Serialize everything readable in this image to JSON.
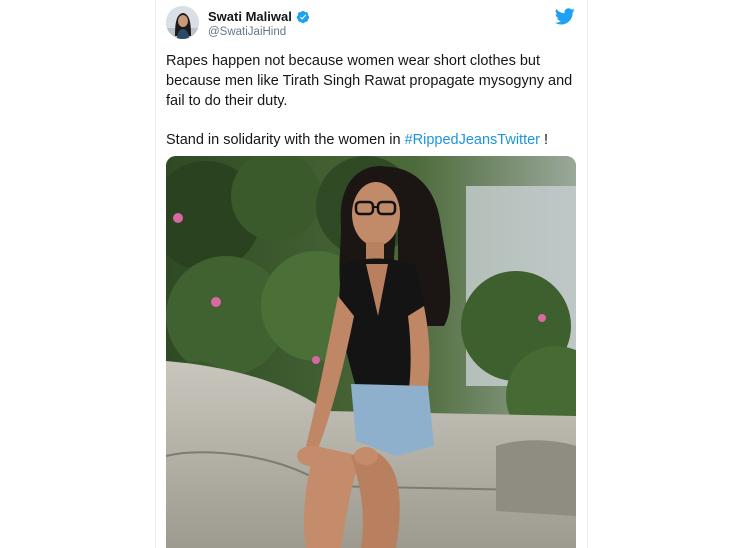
{
  "tweet": {
    "display_name": "Swati Maliwal",
    "handle": "@SwatiJaiHind",
    "verified": true,
    "text_line1": "Rapes happen not because women wear short clothes but because men like Tirath Singh Rawat propagate mysogyny and fail to do their duty.",
    "text_line2_prefix": "Stand in solidarity with the women in ",
    "hashtag": "#RippedJeansTwitter",
    "text_line2_suffix": " !"
  },
  "icons": {
    "brand": "twitter-bird-icon",
    "badge": "verified-badge-icon"
  },
  "colors": {
    "link": "#1b95e0",
    "twitter_blue": "#1da1f2",
    "text": "#14171a",
    "secondary_text": "#657786"
  }
}
